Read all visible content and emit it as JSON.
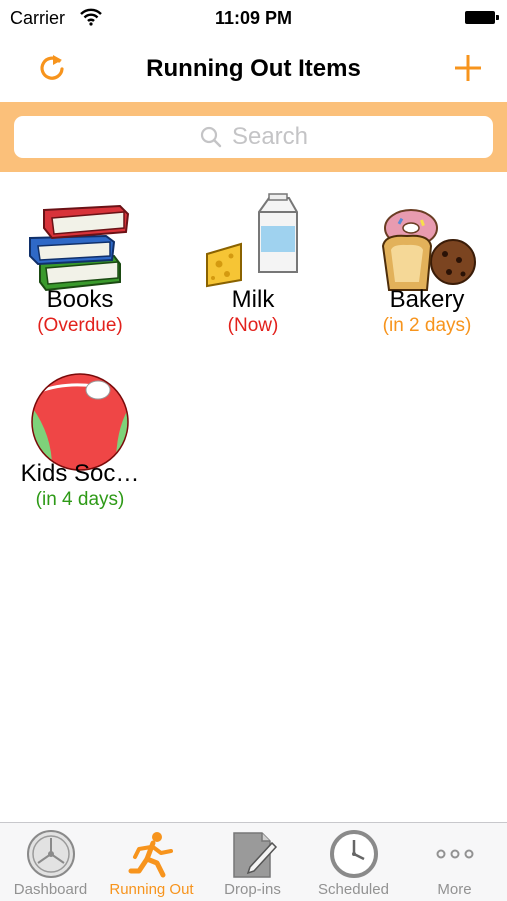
{
  "status_bar": {
    "carrier": "Carrier",
    "time": "11:09 PM"
  },
  "nav": {
    "title": "Running Out Items",
    "refresh_icon": "refresh-icon",
    "add_icon": "plus-icon"
  },
  "search": {
    "placeholder": "Search"
  },
  "items": [
    {
      "name": "Books",
      "status": "(Overdue)",
      "status_color": "red",
      "icon": "books-icon"
    },
    {
      "name": "Milk",
      "status": "(Now)",
      "status_color": "red",
      "icon": "milk-cheese-icon"
    },
    {
      "name": "Bakery",
      "status": "(in 2 days)",
      "status_color": "orange",
      "icon": "bakery-icon"
    },
    {
      "name": "Kids Soc…",
      "status": "(in 4 days)",
      "status_color": "green",
      "icon": "beach-ball-icon"
    }
  ],
  "tabs": [
    {
      "label": "Dashboard",
      "icon": "dashboard-icon",
      "active": false
    },
    {
      "label": "Running Out",
      "icon": "running-person-icon",
      "active": true
    },
    {
      "label": "Drop-ins",
      "icon": "edit-note-icon",
      "active": false
    },
    {
      "label": "Scheduled",
      "icon": "clock-icon",
      "active": false
    },
    {
      "label": "More",
      "icon": "more-dots-icon",
      "active": false
    }
  ],
  "colors": {
    "accent": "#f7941d",
    "search_band": "#fbc07a",
    "overdue": "#e2211c",
    "soon": "#f7941d",
    "later": "#2e9a17"
  }
}
